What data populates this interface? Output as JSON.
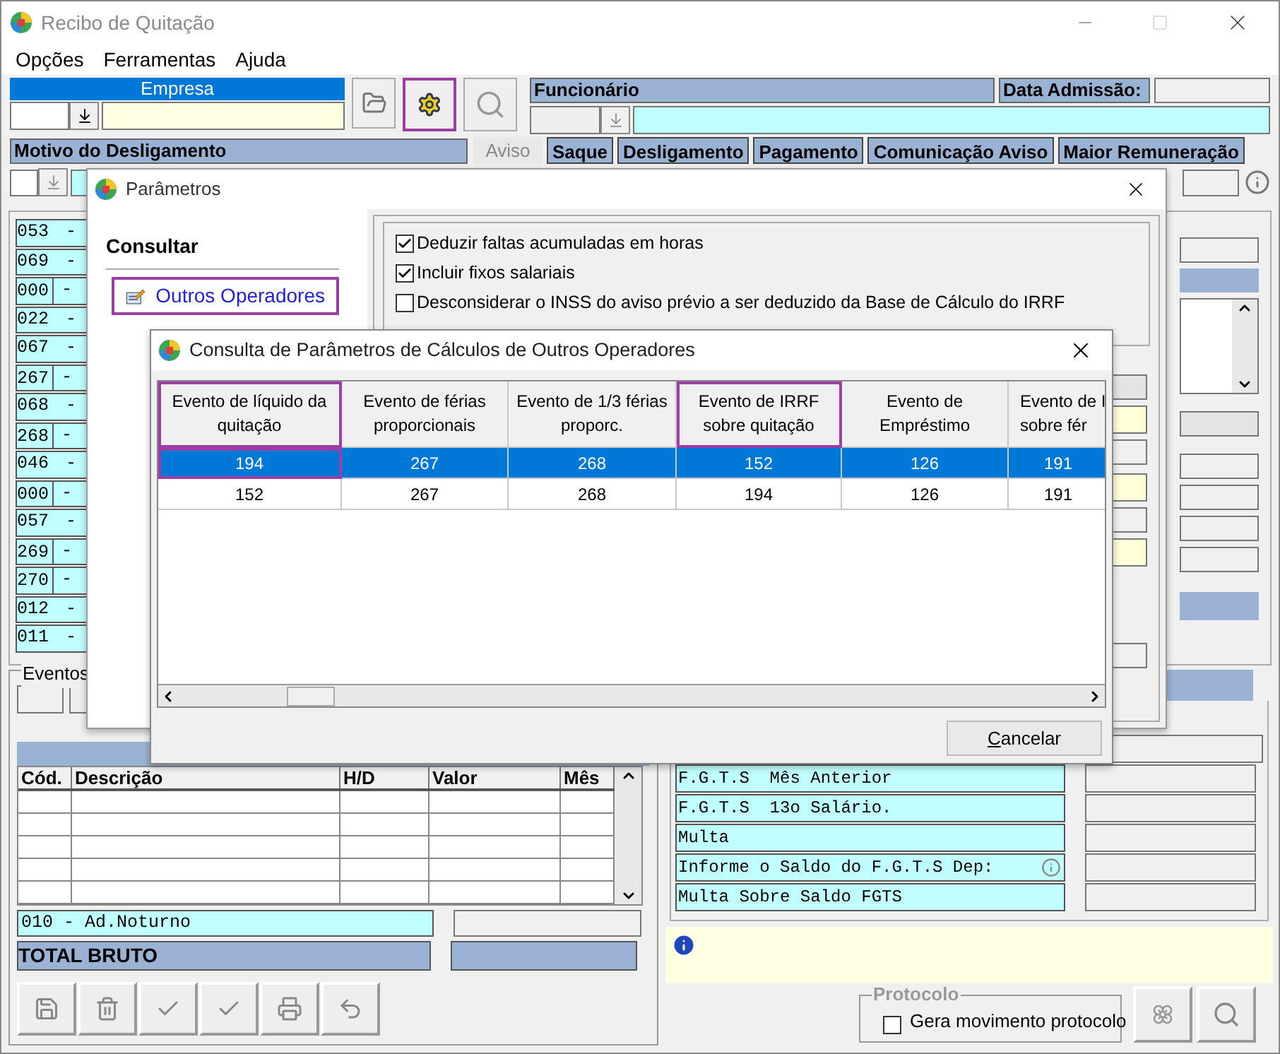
{
  "window": {
    "title": "Recibo de Quitação"
  },
  "menu": [
    "Opções",
    "Ferramentas",
    "Ajuda"
  ],
  "empresa": {
    "label": "Empresa"
  },
  "funcionario": {
    "label": "Funcionário",
    "admission_label": "Data Admissão:"
  },
  "motivo": {
    "label": "Motivo do Desligamento"
  },
  "tabs": [
    {
      "label": "Aviso",
      "disabled": true
    },
    {
      "label": "Saque",
      "disabled": false
    },
    {
      "label": "Desligamento",
      "disabled": false
    },
    {
      "label": "Pagamento",
      "disabled": false
    },
    {
      "label": "Comunicação Aviso",
      "disabled": false
    },
    {
      "label": "Maior Remuneração",
      "disabled": false
    }
  ],
  "event_codes": [
    {
      "code": "053",
      "dash": "-",
      "divided": false
    },
    {
      "code": "069",
      "dash": "-",
      "divided": false
    },
    {
      "code": "000",
      "dash": "-",
      "divided": true
    },
    {
      "code": "022",
      "dash": "-",
      "divided": false
    },
    {
      "code": "067",
      "dash": "-",
      "divided": false
    },
    {
      "code": "267",
      "dash": "-",
      "divided": true
    },
    {
      "code": "068",
      "dash": "-",
      "divided": false
    },
    {
      "code": "268",
      "dash": "-",
      "divided": true
    },
    {
      "code": "046",
      "dash": "-",
      "divided": false
    },
    {
      "code": "000",
      "dash": "-",
      "divided": true
    },
    {
      "code": "057",
      "dash": "-",
      "divided": false
    },
    {
      "code": "269",
      "dash": "-",
      "divided": true
    },
    {
      "code": "270",
      "dash": "-",
      "divided": true
    },
    {
      "code": "012",
      "dash": "-",
      "divided": false
    },
    {
      "code": "011",
      "dash": "-",
      "divided": false
    }
  ],
  "eventos": {
    "label": "Eventos",
    "columns": [
      "Cód.",
      "Descrição",
      "H/D",
      "Valor",
      "Mês"
    ],
    "selected_event": "010 - Ad.Noturno",
    "total_label": "TOTAL BRUTO"
  },
  "fgts_rows": [
    {
      "label": "F.G.T.S  Mês Anterior",
      "info": false
    },
    {
      "label": "F.G.T.S  13o Salário.",
      "info": false
    },
    {
      "label": "Multa",
      "info": false
    },
    {
      "label": "Informe o Saldo do F.G.T.S Dep:",
      "info": true
    },
    {
      "label": "Multa Sobre Saldo FGTS",
      "info": false
    }
  ],
  "protocolo": {
    "label": "Protocolo",
    "option": {
      "label": "Gera movimento protocolo",
      "checked": false
    }
  },
  "parametros": {
    "title": "Parâmetros",
    "section": "Consultar",
    "nav": [
      {
        "label": "Outros Operadores",
        "highlighted": true
      }
    ],
    "options": [
      {
        "label": "Deduzir faltas acumuladas em horas",
        "checked": true
      },
      {
        "label": "Incluir fixos salariais",
        "checked": true
      },
      {
        "label": "Desconsiderar o INSS do aviso prévio a ser deduzido da Base de Cálculo do IRRF",
        "checked": false
      }
    ]
  },
  "consulta": {
    "title": "Consulta de Parâmetros de Cálculos de Outros Operadores",
    "columns": [
      {
        "label": "Evento de líquido da quitação",
        "highlighted": true
      },
      {
        "label": "Evento de férias proporcionais",
        "highlighted": false
      },
      {
        "label": "Evento de 1/3 férias proporc.",
        "highlighted": false
      },
      {
        "label": "Evento de IRRF sobre quitação",
        "highlighted": true
      },
      {
        "label": "Evento de Empréstimo",
        "highlighted": false
      },
      {
        "label": "Evento de I sobre fér",
        "highlighted": false
      }
    ],
    "rows": [
      {
        "selected": true,
        "cells": [
          {
            "value": "194",
            "highlighted": true
          },
          {
            "value": "267",
            "highlighted": false
          },
          {
            "value": "268",
            "highlighted": false
          },
          {
            "value": "152",
            "highlighted": false
          },
          {
            "value": "126",
            "highlighted": false
          },
          {
            "value": "191",
            "highlighted": false
          }
        ]
      },
      {
        "selected": false,
        "cells": [
          {
            "value": "152",
            "highlighted": false
          },
          {
            "value": "267",
            "highlighted": false
          },
          {
            "value": "268",
            "highlighted": false
          },
          {
            "value": "194",
            "highlighted": false
          },
          {
            "value": "126",
            "highlighted": false
          },
          {
            "value": "191",
            "highlighted": false
          }
        ]
      }
    ],
    "cancel": "Cancelar"
  }
}
